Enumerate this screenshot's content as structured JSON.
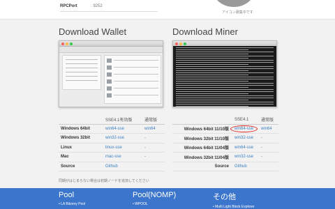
{
  "top": {
    "rpc_label": "RPCPort",
    "rpc_value": ": 9252",
    "avatar_caption": "アイコン募集中です"
  },
  "wallet": {
    "title": "Download Wallet",
    "headers": [
      "",
      "SSE4.1有効版",
      "通常版"
    ],
    "rows": [
      {
        "label": "Windows 64bit",
        "sse": "win64-sse",
        "normal": "win64"
      },
      {
        "label": "Windows 32bit",
        "sse": "win32-sse",
        "normal": "-"
      },
      {
        "label": "Linux",
        "sse": "linux-sse",
        "normal": "-"
      },
      {
        "label": "Mac",
        "sse": "mac-sse",
        "normal": "-"
      },
      {
        "label": "Source",
        "sse": "Github",
        "normal": ""
      }
    ],
    "note": "同期がはじまらない場合は初期ノードを追加してください"
  },
  "miner": {
    "title": "Download Miner",
    "headers": [
      "",
      "SSE4.1",
      "通常版"
    ],
    "rows": [
      {
        "label": "Windows 64bit 11/10版",
        "sse": "win64-sse",
        "normal": "win64"
      },
      {
        "label": "Windows 32bit 11/10版",
        "sse": "win32-sse",
        "normal": "-"
      },
      {
        "label": "Windows 64bit 11/04版",
        "sse": "win64-sse",
        "normal": "-"
      },
      {
        "label": "Windows 32bit 11/04版",
        "sse": "win32-sse",
        "normal": "-"
      },
      {
        "label": "Source",
        "sse": "Github",
        "normal": ""
      }
    ]
  },
  "footer": {
    "col1": {
      "title": "Pool",
      "item": "LA Bitzeny Pool"
    },
    "col2": {
      "title": "Pool(NOMP)",
      "item": "WPOOL"
    },
    "col3": {
      "title": "その他",
      "item": "Multi Light Block Explorer"
    }
  },
  "colors": {
    "link": "#3a7fc1",
    "footer": "#3c76cc",
    "highlight": "#e0201b"
  }
}
